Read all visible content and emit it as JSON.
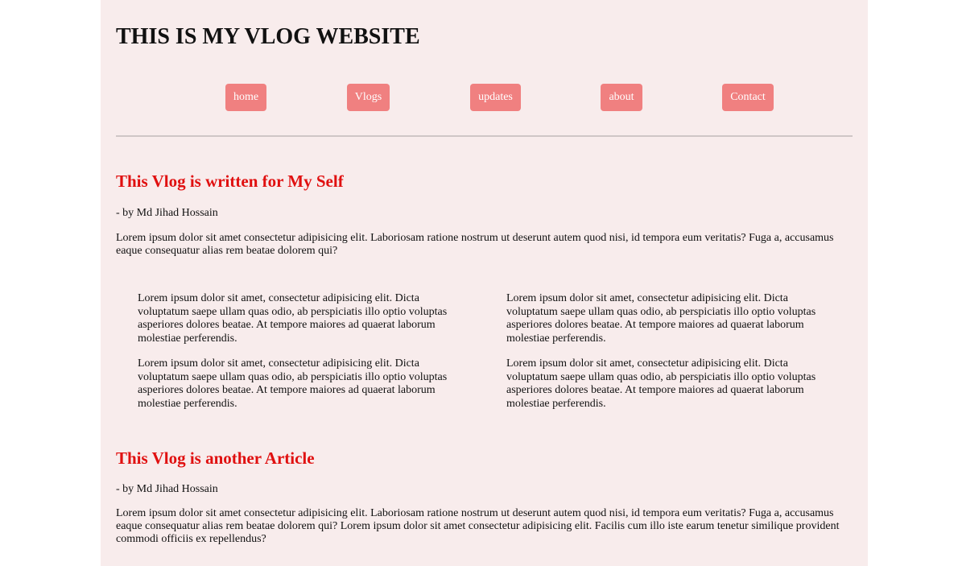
{
  "header": {
    "title": "THIS IS MY VLOG WEBSITE"
  },
  "nav": {
    "items": [
      {
        "label": "home"
      },
      {
        "label": "Vlogs"
      },
      {
        "label": "updates"
      },
      {
        "label": "about"
      },
      {
        "label": "Contact"
      }
    ]
  },
  "articles": [
    {
      "title": "This Vlog is written for My Self",
      "byline": "- by Md Jihad Hossain",
      "body": "Lorem ipsum dolor sit amet consectetur adipisicing elit. Laboriosam ratione nostrum ut deserunt autem quod nisi, id tempora eum veritatis? Fuga a, accusamus eaque consequatur alias rem beatae dolorem qui?",
      "grid": [
        "Lorem ipsum dolor sit amet, consectetur adipisicing elit. Dicta voluptatum saepe ullam quas odio, ab perspiciatis illo optio voluptas asperiores dolores beatae. At tempore maiores ad quaerat laborum molestiae perferendis.",
        "Lorem ipsum dolor sit amet, consectetur adipisicing elit. Dicta voluptatum saepe ullam quas odio, ab perspiciatis illo optio voluptas asperiores dolores beatae. At tempore maiores ad quaerat laborum molestiae perferendis.",
        "Lorem ipsum dolor sit amet, consectetur adipisicing elit. Dicta voluptatum saepe ullam quas odio, ab perspiciatis illo optio voluptas asperiores dolores beatae. At tempore maiores ad quaerat laborum molestiae perferendis.",
        "Lorem ipsum dolor sit amet, consectetur adipisicing elit. Dicta voluptatum saepe ullam quas odio, ab perspiciatis illo optio voluptas asperiores dolores beatae. At tempore maiores ad quaerat laborum molestiae perferendis."
      ]
    },
    {
      "title": "This Vlog is another Article",
      "byline": "- by Md Jihad Hossain",
      "body": "Lorem ipsum dolor sit amet consectetur adipisicing elit. Laboriosam ratione nostrum ut deserunt autem quod nisi, id tempora eum veritatis? Fuga a, accusamus eaque consequatur alias rem beatae dolorem qui? Lorem ipsum dolor sit amet consectetur adipisicing elit. Facilis cum illo iste earum tenetur similique provident commodi officiis ex repellendus?"
    }
  ],
  "colors": {
    "page_background": "#f8ecec",
    "nav_button": "#f08080",
    "article_title": "#e01010"
  }
}
